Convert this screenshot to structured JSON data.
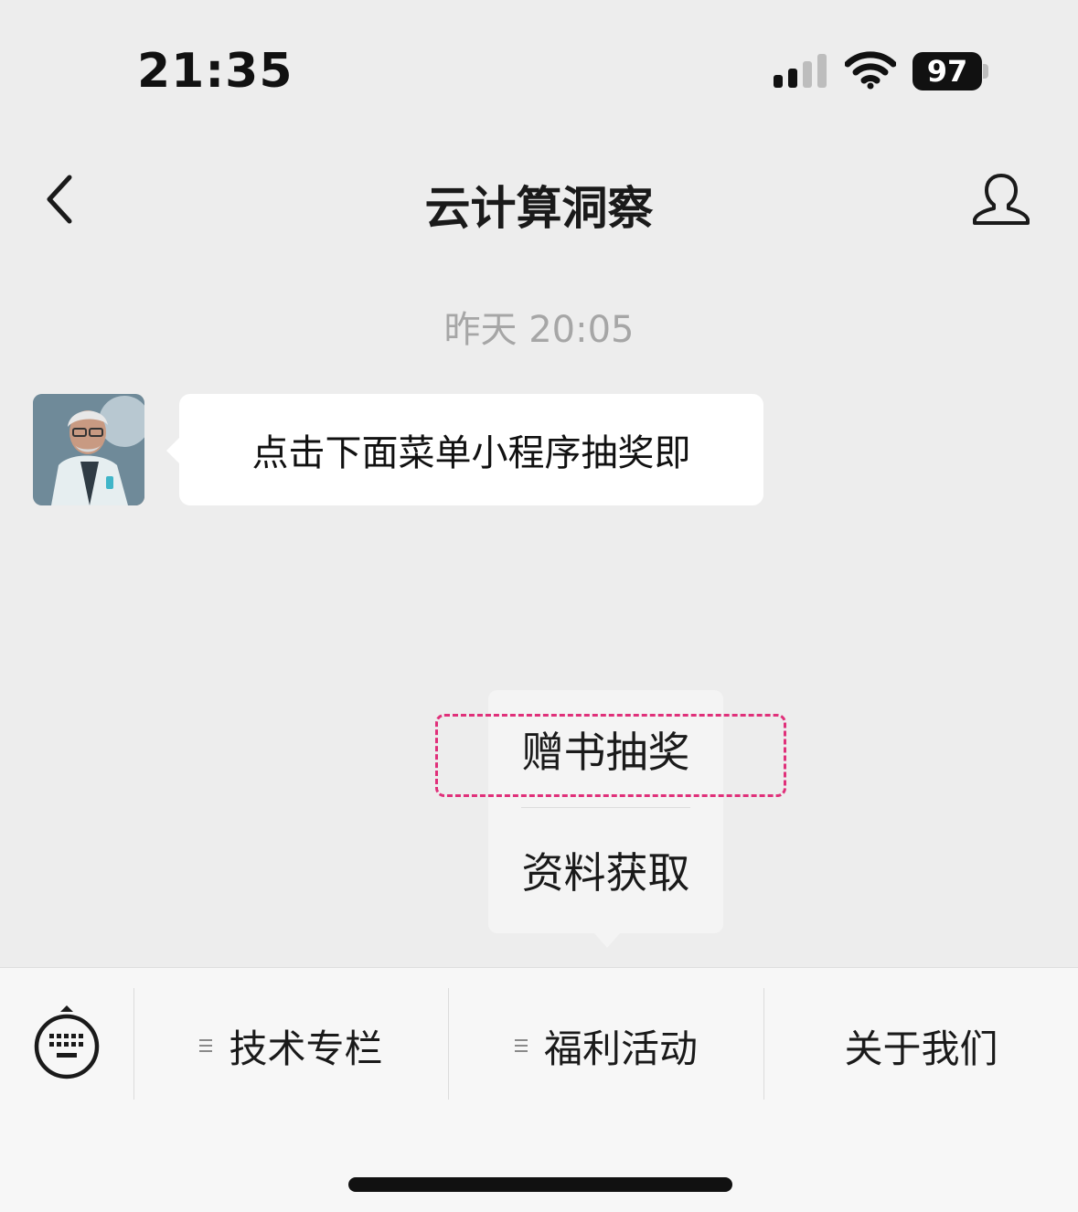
{
  "status_bar": {
    "time": "21:35",
    "battery": "97",
    "icons": [
      "cellular-signal-icon",
      "wifi-icon",
      "battery-icon"
    ]
  },
  "nav": {
    "title": "云计算洞察",
    "back_icon": "chevron-left-icon",
    "profile_icon": "person-icon"
  },
  "chat": {
    "timestamp": "昨天 20:05",
    "messages": [
      {
        "sender": "official-account",
        "text": "点击下面菜单小程序抽奖即"
      }
    ]
  },
  "popup_menu": {
    "items": [
      {
        "label": "赠书抽奖",
        "highlighted": true
      },
      {
        "label": "资料获取"
      }
    ],
    "highlight_color": "#e0307a"
  },
  "bottom_menu": {
    "keyboard_icon": "keyboard-icon",
    "items": [
      {
        "label": "技术专栏",
        "has_submenu": true
      },
      {
        "label": "福利活动",
        "has_submenu": true
      },
      {
        "label": "关于我们",
        "has_submenu": false
      }
    ]
  },
  "colors": {
    "background": "#ededed",
    "bubble": "#ffffff",
    "menu_bar": "#f7f7f7",
    "timestamp": "#a6a6a6"
  }
}
